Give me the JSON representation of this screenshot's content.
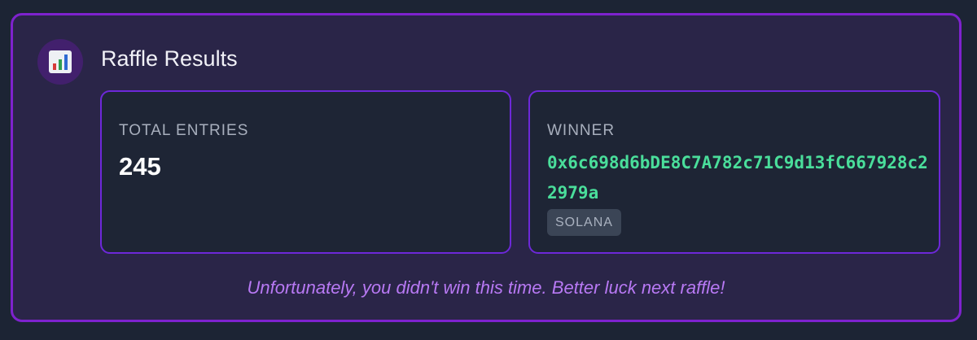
{
  "header": {
    "icon": "bar-chart-icon",
    "title": "Raffle Results"
  },
  "entries": {
    "label": "TOTAL ENTRIES",
    "value": "245"
  },
  "winner": {
    "label": "WINNER",
    "address": "0x6c698d6bDE8C7A782c71C9d13fC667928c22979a",
    "chain": "SOLANA"
  },
  "message": "Unfortunately, you didn't win this time. Better luck next raffle!",
  "colors": {
    "accent_border": "#7e22ce",
    "card_bg": "#2a2548",
    "panel_bg": "#1e2535",
    "address": "#4ade9b",
    "message": "#b879f4"
  }
}
